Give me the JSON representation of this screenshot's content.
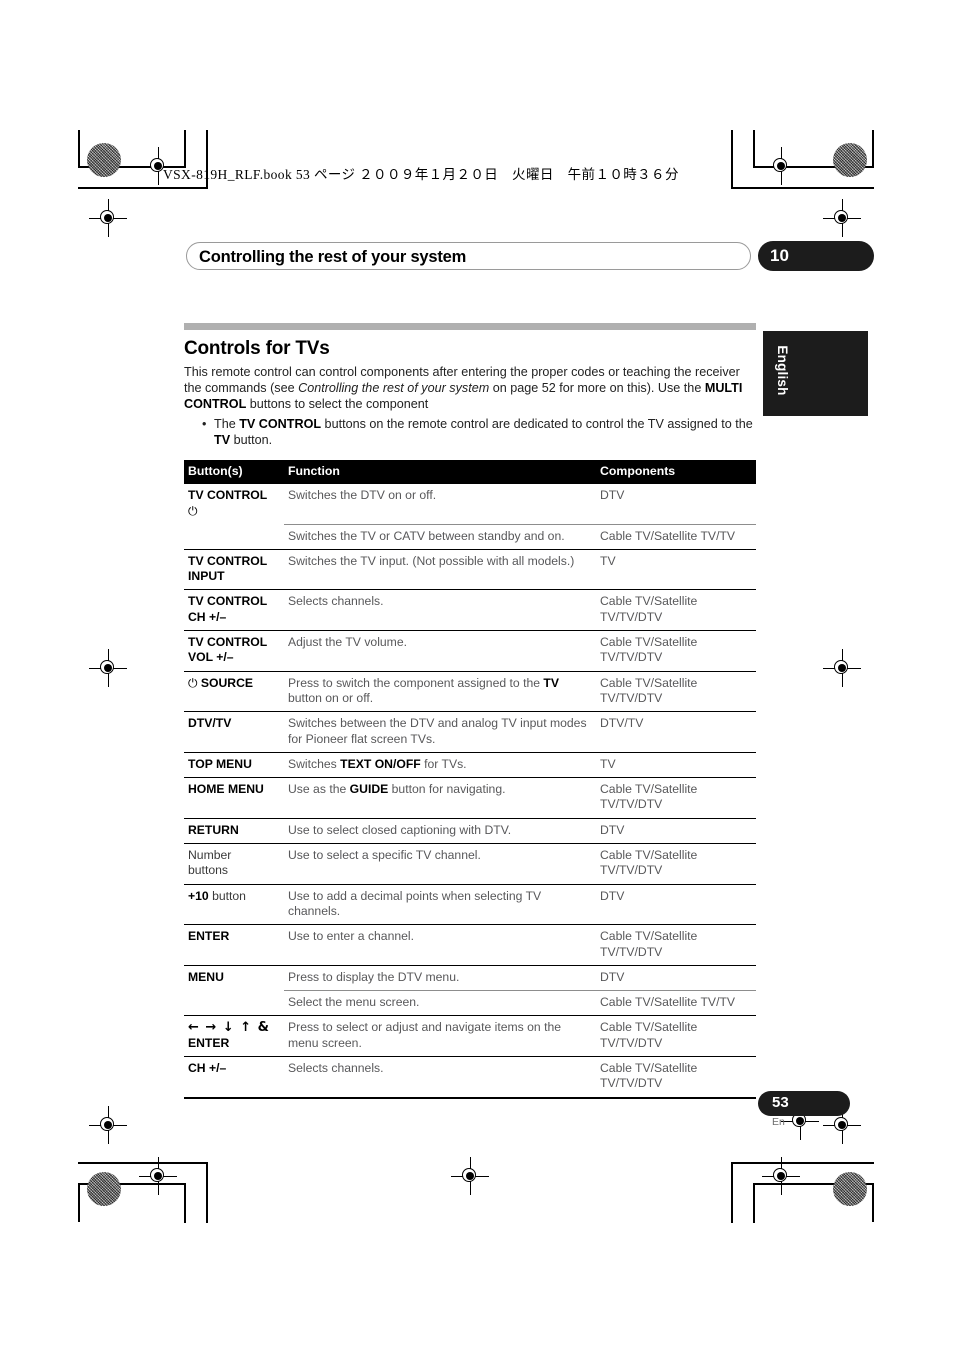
{
  "file_header": "VSX-819H_RLF.book    53 ページ    ２００９年１月２０日　火曜日　午前１０時３６分",
  "running_head": {
    "title": "Controlling the rest of your system",
    "chapter_number": "10"
  },
  "side_tab": {
    "label": "English"
  },
  "section": {
    "title": "Controls for TVs",
    "intro_part1": "This remote control can control components after entering the proper codes or teaching the receiver the commands (see ",
    "intro_italic": "Controlling the rest of your system",
    "intro_part2": " on page 52 for more on this). Use the ",
    "intro_bold": "MULTI CONTROL",
    "intro_part3": " buttons to select the component",
    "bullets": [
      {
        "pre": "The ",
        "bold": "TV CONTROL",
        "mid": " buttons on the remote control are dedicated to control the TV assigned to the ",
        "bold2": "TV",
        "post": " button."
      }
    ]
  },
  "table": {
    "headers": [
      "Button(s)",
      "Function",
      "Components"
    ],
    "rows": [
      {
        "sep": true,
        "button": "TV CONTROL",
        "button_icon": "power-icon",
        "button_icon_glyph": "⏻",
        "function": "Switches the DTV on or off.",
        "components": "DTV"
      },
      {
        "sub": true,
        "button": "",
        "function": "Switches the TV or CATV between standby and on.",
        "components": "Cable TV/Satellite TV/TV"
      },
      {
        "sep": true,
        "button": "TV CONTROL INPUT",
        "function": "Switches the TV input. (Not possible with all models.)",
        "components": "TV"
      },
      {
        "sep": true,
        "button": "TV CONTROL CH +/–",
        "function": "Selects channels.",
        "components": "Cable TV/Satellite TV/TV/DTV"
      },
      {
        "sep": true,
        "button": "TV CONTROL VOL +/–",
        "function": "Adjust the TV volume.",
        "components": "Cable TV/Satellite TV/TV/DTV"
      },
      {
        "sep": true,
        "button": "SOURCE",
        "button_icon": "power-icon",
        "button_icon_glyph": "⏻",
        "icon_before": true,
        "function_pre": "Press to switch the component assigned to the ",
        "function_bold": "TV",
        "function_post": " button on or off.",
        "components": "Cable TV/Satellite TV/TV/DTV"
      },
      {
        "sep": true,
        "button": "DTV/TV",
        "function": "Switches between the DTV and analog TV input modes for Pioneer flat screen TVs.",
        "components": "DTV/TV"
      },
      {
        "sep": true,
        "button": "TOP MENU",
        "function_pre": "Switches ",
        "function_bold": "TEXT ON/OFF",
        "function_post": " for TVs.",
        "components": "TV"
      },
      {
        "sub": true,
        "full_sep": true,
        "button": "HOME MENU",
        "function_pre": "Use as the ",
        "function_bold": "GUIDE",
        "function_post": " button for navigating.",
        "components": "Cable TV/Satellite TV/TV/DTV"
      },
      {
        "sub": true,
        "full_sep": true,
        "button": "RETURN",
        "function": "Use to select closed captioning with DTV.",
        "components": "DTV"
      },
      {
        "sep": true,
        "button": "Number buttons",
        "button_regular": true,
        "function": "Use to select a specific TV channel.",
        "components": "Cable TV/Satellite TV/TV/DTV"
      },
      {
        "sep": true,
        "button": "+10",
        "button_suffix": " button",
        "function": "Use to add a decimal points when selecting TV channels.",
        "components": "DTV"
      },
      {
        "sep": true,
        "button": "ENTER",
        "function": "Use to enter a channel.",
        "components": "Cable TV/Satellite TV/TV/DTV"
      },
      {
        "sep": true,
        "button": "MENU",
        "function": "Press to display the DTV menu.",
        "components": "DTV"
      },
      {
        "sub": true,
        "button": "",
        "function": "Select the menu screen.",
        "components": "Cable TV/Satellite TV/TV"
      },
      {
        "sep": true,
        "button_arrows": "← → ↓ ↑ &",
        "button": "ENTER",
        "function": "Press to select or adjust and navigate items on the menu screen.",
        "components": "Cable TV/Satellite TV/TV/DTV"
      },
      {
        "sep": true,
        "button": "CH +/–",
        "function": "Selects channels.",
        "components": "Cable TV/Satellite TV/TV/DTV"
      }
    ]
  },
  "page_footer": {
    "number": "53",
    "language_code": "En"
  },
  "colors": {
    "header_bar": "#000000",
    "gray_rule": "#b0b0b0",
    "body_text": "#58585a",
    "tab_black": "#1c1c1c"
  }
}
